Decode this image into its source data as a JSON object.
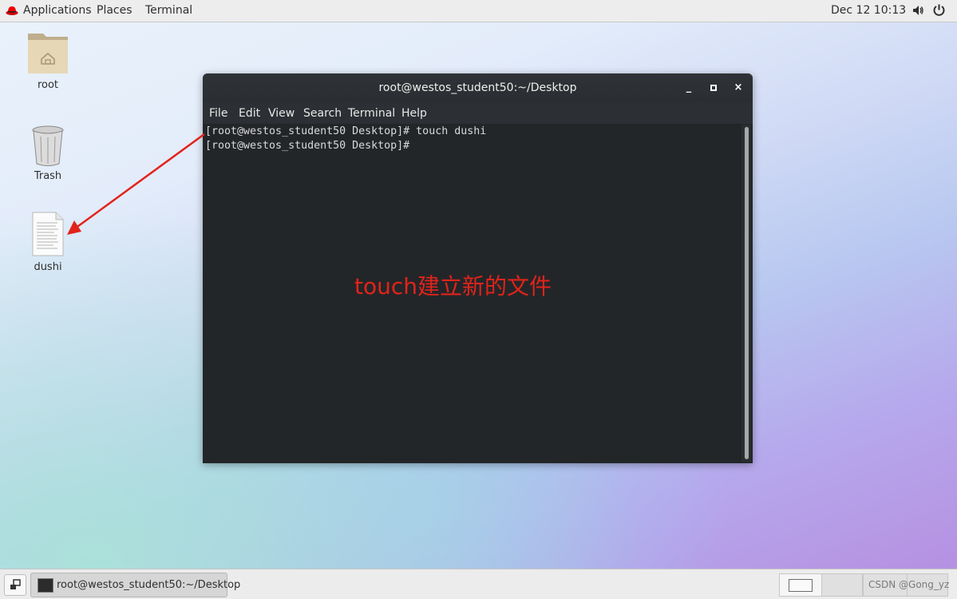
{
  "topbar": {
    "applications": "Applications",
    "places": "Places",
    "terminal": "Terminal",
    "datetime": "Dec 12  10:13",
    "icons": [
      "redhat-logo-icon",
      "volume-icon",
      "power-icon"
    ]
  },
  "desktop": {
    "icons": [
      {
        "label": "root",
        "icon": "home-folder-icon"
      },
      {
        "label": "Trash",
        "icon": "trash-icon"
      },
      {
        "label": "dushi",
        "icon": "text-file-icon"
      }
    ]
  },
  "window": {
    "title": "root@westos_student50:~/Desktop",
    "controls": {
      "minimize": "_",
      "maximize": "□",
      "close": "×"
    },
    "menu": [
      "File",
      "Edit",
      "View",
      "Search",
      "Terminal",
      "Help"
    ],
    "terminal_lines": [
      "[root@westos_student50 Desktop]# touch dushi",
      "[root@westos_student50 Desktop]#"
    ]
  },
  "annotation": {
    "text": "touch建立新的文件",
    "color": "#e2231a"
  },
  "bottombar": {
    "task_label": "root@westos_student50:~/Desktop",
    "watermark": "CSDN @Gong_yz",
    "workspaces": 4
  },
  "colors": {
    "terminal_bg": "#232629",
    "titlebar_bg": "#2f3337",
    "annotation_red": "#e2231a"
  }
}
